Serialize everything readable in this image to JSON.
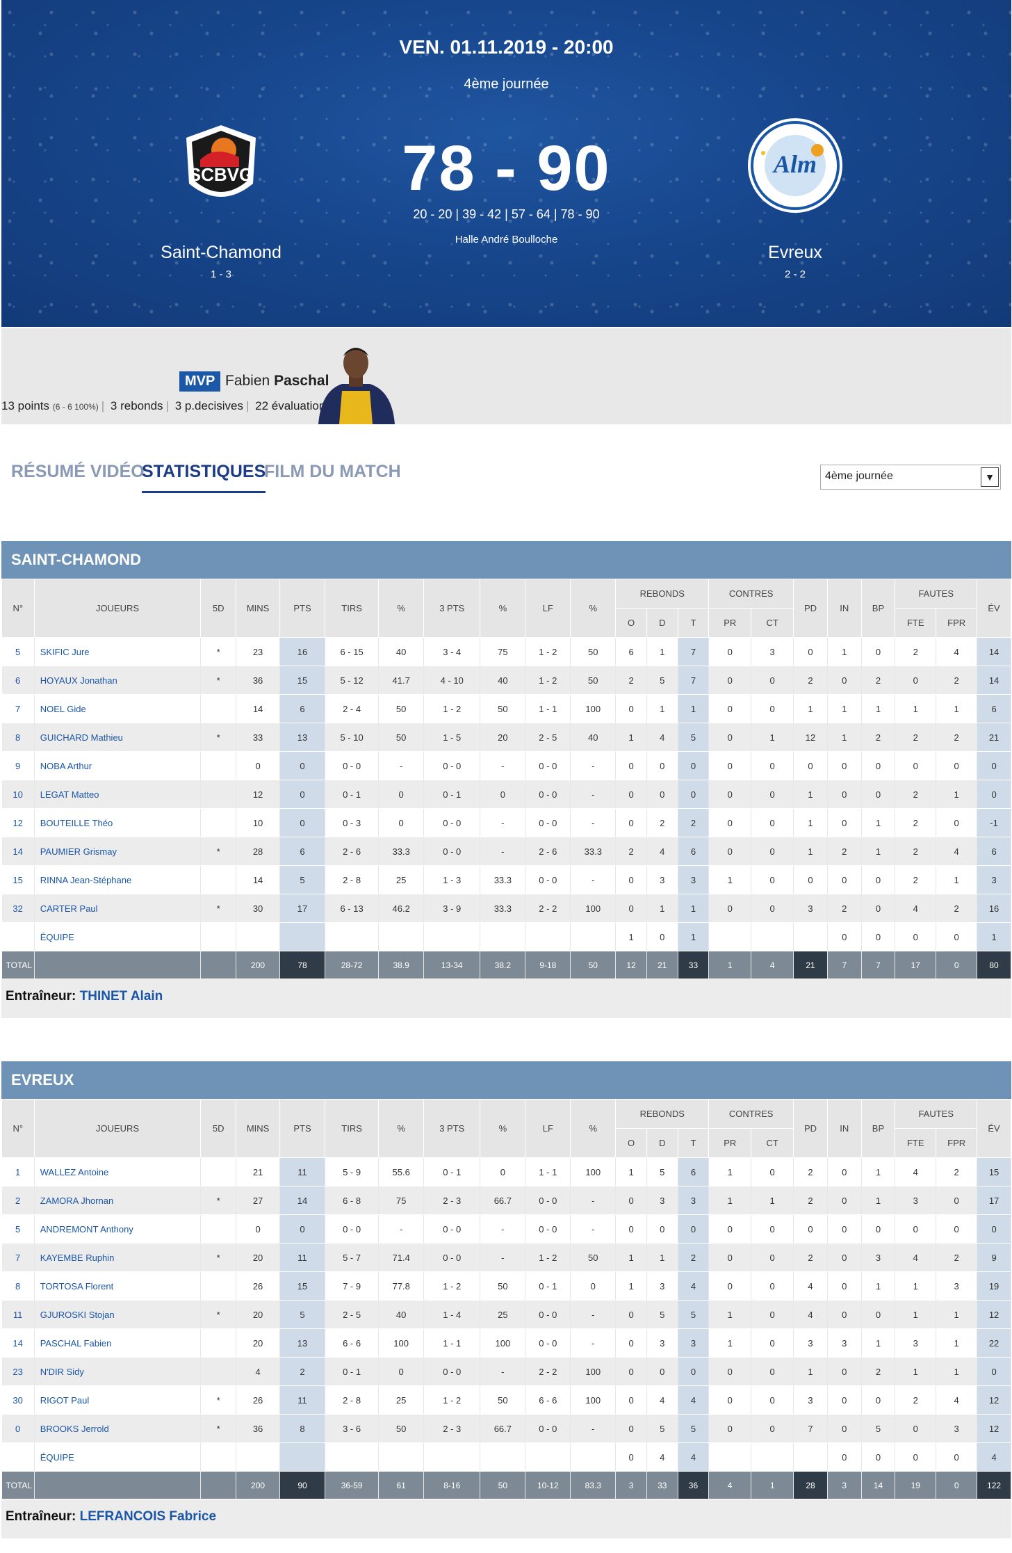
{
  "match": {
    "date": "VEN. 01.11.2019 - 20:00",
    "round": "4ème journée",
    "score": "78 - 90",
    "quarters": "20 - 20 | 39 - 42 | 57 - 64 | 78 - 90",
    "arena": "Halle André Boulloche"
  },
  "home": {
    "name": "Saint-Chamond",
    "record": "1 - 3",
    "logo_text": "SCBVG"
  },
  "away": {
    "name": "Evreux",
    "record": "2 - 2",
    "logo_text": "Alm"
  },
  "mvp": {
    "tag": "MVP",
    "first": "Fabien",
    "last": "Paschal",
    "points": "13 points",
    "shooting": "(6 - 6 100%)",
    "rebounds": "3 rebonds",
    "assists": "3 p.decisives",
    "eval": "22 évaluation"
  },
  "tabs": [
    "RÉSUMÉ VIDÉO",
    "STATISTIQUES",
    "FILM DU MATCH"
  ],
  "round_select": "4ème journée",
  "columns": {
    "top": [
      "N°",
      "JOUEURS",
      "5D",
      "MINS",
      "PTS",
      "TIRS",
      "%",
      "3 PTS",
      "%",
      "LF",
      "%",
      "REBONDS",
      "CONTRES",
      "PD",
      "IN",
      "BP",
      "FAUTES",
      "ÉV"
    ],
    "sub": [
      "O",
      "D",
      "T",
      "PR",
      "CT",
      "FTE",
      "FPR"
    ]
  },
  "teams": [
    {
      "title": "SAINT-CHAMOND",
      "coach_label": "Entraîneur:",
      "coach": "THINET Alain",
      "rows": [
        [
          "5",
          "SKIFIC Jure",
          "*",
          "23",
          "16",
          "6 - 15",
          "40",
          "3 - 4",
          "75",
          "1 - 2",
          "50",
          "6",
          "1",
          "7",
          "0",
          "3",
          "0",
          "1",
          "0",
          "2",
          "4",
          "14"
        ],
        [
          "6",
          "HOYAUX Jonathan",
          "*",
          "36",
          "15",
          "5 - 12",
          "41.7",
          "4 - 10",
          "40",
          "1 - 2",
          "50",
          "2",
          "5",
          "7",
          "0",
          "0",
          "2",
          "0",
          "2",
          "0",
          "2",
          "14"
        ],
        [
          "7",
          "NOEL Gide",
          "",
          "14",
          "6",
          "2 - 4",
          "50",
          "1 - 2",
          "50",
          "1 - 1",
          "100",
          "0",
          "1",
          "1",
          "0",
          "0",
          "1",
          "1",
          "1",
          "1",
          "1",
          "6"
        ],
        [
          "8",
          "GUICHARD Mathieu",
          "*",
          "33",
          "13",
          "5 - 10",
          "50",
          "1 - 5",
          "20",
          "2 - 5",
          "40",
          "1",
          "4",
          "5",
          "0",
          "1",
          "12",
          "1",
          "2",
          "2",
          "2",
          "21"
        ],
        [
          "9",
          "NOBA Arthur",
          "",
          "0",
          "0",
          "0 - 0",
          "-",
          "0 - 0",
          "-",
          "0 - 0",
          "-",
          "0",
          "0",
          "0",
          "0",
          "0",
          "0",
          "0",
          "0",
          "0",
          "0",
          "0"
        ],
        [
          "10",
          "LEGAT Matteo",
          "",
          "12",
          "0",
          "0 - 1",
          "0",
          "0 - 1",
          "0",
          "0 - 0",
          "-",
          "0",
          "0",
          "0",
          "0",
          "0",
          "1",
          "0",
          "0",
          "2",
          "1",
          "0"
        ],
        [
          "12",
          "BOUTEILLE Théo",
          "",
          "10",
          "0",
          "0 - 3",
          "0",
          "0 - 0",
          "-",
          "0 - 0",
          "-",
          "0",
          "2",
          "2",
          "0",
          "0",
          "1",
          "0",
          "1",
          "2",
          "0",
          "-1"
        ],
        [
          "14",
          "PAUMIER Grismay",
          "*",
          "28",
          "6",
          "2 - 6",
          "33.3",
          "0 - 0",
          "-",
          "2 - 6",
          "33.3",
          "2",
          "4",
          "6",
          "0",
          "0",
          "1",
          "2",
          "1",
          "2",
          "4",
          "6"
        ],
        [
          "15",
          "RINNA Jean-Stéphane",
          "",
          "14",
          "5",
          "2 - 8",
          "25",
          "1 - 3",
          "33.3",
          "0 - 0",
          "-",
          "0",
          "3",
          "3",
          "1",
          "0",
          "0",
          "0",
          "0",
          "2",
          "1",
          "3"
        ],
        [
          "32",
          "CARTER Paul",
          "*",
          "30",
          "17",
          "6 - 13",
          "46.2",
          "3 - 9",
          "33.3",
          "2 - 2",
          "100",
          "0",
          "1",
          "1",
          "0",
          "0",
          "3",
          "2",
          "0",
          "4",
          "2",
          "16"
        ],
        [
          "",
          "ÉQUIPE",
          "",
          "",
          "",
          "",
          "",
          "",
          "",
          "",
          "",
          "1",
          "0",
          "1",
          "",
          "",
          "",
          "0",
          "0",
          "0",
          "0",
          "1"
        ]
      ],
      "total": [
        "TOTAL",
        "",
        "",
        "200",
        "78",
        "28-72",
        "38.9",
        "13-34",
        "38.2",
        "9-18",
        "50",
        "12",
        "21",
        "33",
        "1",
        "4",
        "21",
        "7",
        "7",
        "17",
        "0",
        "80"
      ]
    },
    {
      "title": "EVREUX",
      "coach_label": "Entraîneur:",
      "coach": "LEFRANCOIS Fabrice",
      "rows": [
        [
          "1",
          "WALLEZ Antoine",
          "",
          "21",
          "11",
          "5 - 9",
          "55.6",
          "0 - 1",
          "0",
          "1 - 1",
          "100",
          "1",
          "5",
          "6",
          "1",
          "0",
          "2",
          "0",
          "1",
          "4",
          "2",
          "15"
        ],
        [
          "2",
          "ZAMORA Jhornan",
          "*",
          "27",
          "14",
          "6 - 8",
          "75",
          "2 - 3",
          "66.7",
          "0 - 0",
          "-",
          "0",
          "3",
          "3",
          "1",
          "1",
          "2",
          "0",
          "1",
          "3",
          "0",
          "17"
        ],
        [
          "5",
          "ANDREMONT Anthony",
          "",
          "0",
          "0",
          "0 - 0",
          "-",
          "0 - 0",
          "-",
          "0 - 0",
          "-",
          "0",
          "0",
          "0",
          "0",
          "0",
          "0",
          "0",
          "0",
          "0",
          "0",
          "0"
        ],
        [
          "7",
          "KAYEMBE Ruphin",
          "*",
          "20",
          "11",
          "5 - 7",
          "71.4",
          "0 - 0",
          "-",
          "1 - 2",
          "50",
          "1",
          "1",
          "2",
          "0",
          "0",
          "2",
          "0",
          "3",
          "4",
          "2",
          "9"
        ],
        [
          "8",
          "TORTOSA Florent",
          "",
          "26",
          "15",
          "7 - 9",
          "77.8",
          "1 - 2",
          "50",
          "0 - 1",
          "0",
          "1",
          "3",
          "4",
          "0",
          "0",
          "4",
          "0",
          "1",
          "1",
          "3",
          "19"
        ],
        [
          "11",
          "GJUROSKI Stojan",
          "*",
          "20",
          "5",
          "2 - 5",
          "40",
          "1 - 4",
          "25",
          "0 - 0",
          "-",
          "0",
          "5",
          "5",
          "1",
          "0",
          "4",
          "0",
          "0",
          "1",
          "1",
          "12"
        ],
        [
          "14",
          "PASCHAL Fabien",
          "",
          "20",
          "13",
          "6 - 6",
          "100",
          "1 - 1",
          "100",
          "0 - 0",
          "-",
          "0",
          "3",
          "3",
          "1",
          "0",
          "3",
          "3",
          "1",
          "3",
          "1",
          "22"
        ],
        [
          "23",
          "N'DIR Sidy",
          "",
          "4",
          "2",
          "0 - 1",
          "0",
          "0 - 0",
          "-",
          "2 - 2",
          "100",
          "0",
          "0",
          "0",
          "0",
          "0",
          "1",
          "0",
          "2",
          "1",
          "1",
          "0"
        ],
        [
          "30",
          "RIGOT Paul",
          "*",
          "26",
          "11",
          "2 - 8",
          "25",
          "1 - 2",
          "50",
          "6 - 6",
          "100",
          "0",
          "4",
          "4",
          "0",
          "0",
          "3",
          "0",
          "0",
          "2",
          "4",
          "12"
        ],
        [
          "0",
          "BROOKS Jerrold",
          "*",
          "36",
          "8",
          "3 - 6",
          "50",
          "2 - 3",
          "66.7",
          "0 - 0",
          "-",
          "0",
          "5",
          "5",
          "0",
          "0",
          "7",
          "0",
          "5",
          "0",
          "3",
          "12"
        ],
        [
          "",
          "ÉQUIPE",
          "",
          "",
          "",
          "",
          "",
          "",
          "",
          "",
          "",
          "0",
          "4",
          "4",
          "",
          "",
          "",
          "0",
          "0",
          "0",
          "0",
          "4"
        ]
      ],
      "total": [
        "TOTAL",
        "",
        "",
        "200",
        "90",
        "36-59",
        "61",
        "8-16",
        "50",
        "10-12",
        "83.3",
        "3",
        "33",
        "36",
        "4",
        "1",
        "28",
        "3",
        "14",
        "19",
        "0",
        "122"
      ]
    }
  ],
  "colors": {
    "hero": "#17468c",
    "accent": "#1a56a6",
    "team_bar": "#6f93b6",
    "total_bar": "#7d8a96",
    "total_dark": "#2f3b47"
  }
}
